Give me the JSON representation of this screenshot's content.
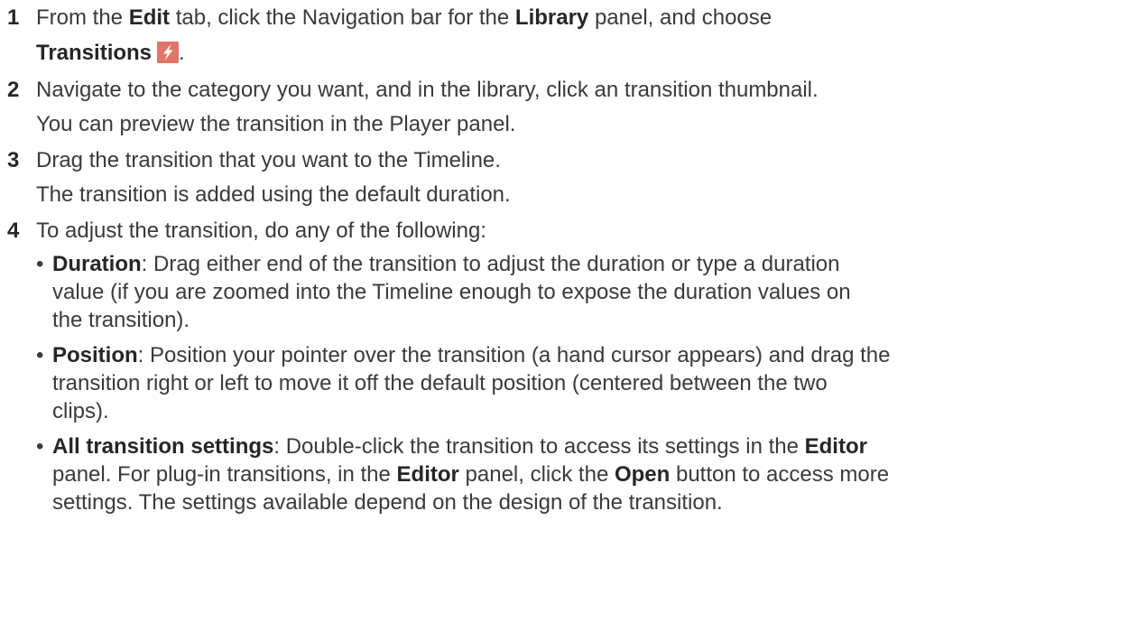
{
  "steps": [
    {
      "number": "1",
      "line1": {
        "pre": "From the ",
        "b1": "Edit",
        "mid": " tab, click the Navigation bar for the ",
        "b2": "Library",
        "post": " panel, and choose"
      },
      "line2": {
        "b": "Transitions",
        "icon": "lightning-bolt-icon",
        "post": "."
      }
    },
    {
      "number": "2",
      "text": "Navigate to the category you want, and in the library, click an transition thumbnail.",
      "note": "You can preview the transition in the Player panel."
    },
    {
      "number": "3",
      "text": "Drag the transition that you want to the Timeline.",
      "note": "The transition is added using the default duration."
    },
    {
      "number": "4",
      "text": "To adjust the transition, do any of the following:",
      "bullets": [
        {
          "term": "Duration",
          "lines": [
            ": Drag either end of the transition to adjust the duration or type a duration",
            "value (if you are zoomed into the Timeline enough to expose the duration values on",
            "the transition)."
          ]
        },
        {
          "term": "Position",
          "lines": [
            ": Position your pointer over the transition (a hand cursor appears) and drag the",
            "transition right or left to move it off the default position (centered between the two",
            "clips)."
          ]
        },
        {
          "term": "All transition settings",
          "line1_rest": ": Double-click the transition to access its settings in the ",
          "line1_b": "Editor",
          "line2_pre": "panel. For plug-in transitions, in the ",
          "line2_b1": "Editor",
          "line2_mid": " panel, click the ",
          "line2_b2": "Open",
          "line2_post": " button to access more",
          "line3": "settings. The settings available depend on the design of the transition."
        }
      ]
    }
  ],
  "colors": {
    "text": "#3a3a3a",
    "bold": "#262626",
    "icon_bg": "#e2756a"
  }
}
